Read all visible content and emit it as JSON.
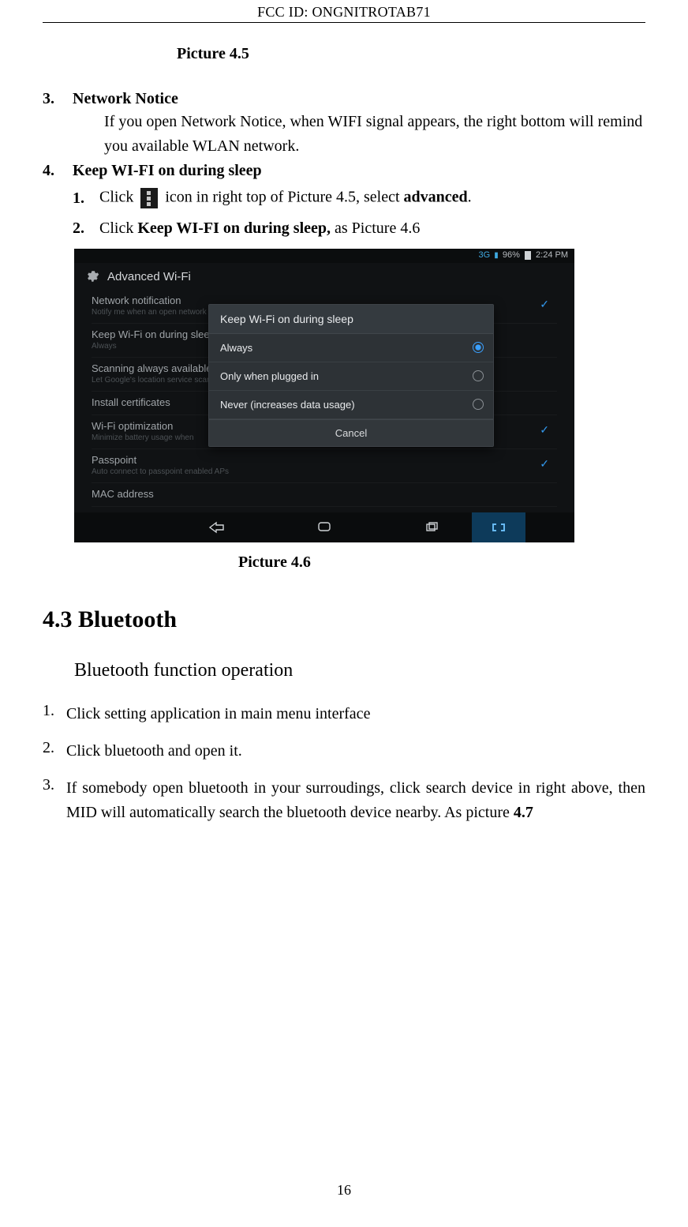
{
  "header": {
    "fcc_id": "FCC ID:  ONGNITROTAB71"
  },
  "captions": {
    "picture_45": "Picture 4.5",
    "picture_46": "Picture 4.6"
  },
  "list_main": {
    "item3": {
      "num": "3.",
      "heading": "Network Notice",
      "body": "If you open Network Notice, when WIFI signal appears, the right bottom will remind you available WLAN network."
    },
    "item4": {
      "num": "4.",
      "heading": "Keep WI-FI on during sleep",
      "sub1": {
        "num": "1.",
        "prefix": "Click ",
        "iconName": "menu-dots-icon",
        "mid": " icon in right top of Picture 4.5, select ",
        "bold": "advanced",
        "suffix": "."
      },
      "sub2": {
        "num": "2.",
        "prefix": "Click ",
        "bold": "Keep WI-FI on during sleep,",
        "suffix": " as Picture 4.6"
      }
    }
  },
  "screenshot": {
    "status": {
      "signal": "3G",
      "battery_pct": "96%",
      "time": "2:24 PM"
    },
    "title": "Advanced Wi-Fi",
    "rows": {
      "r1": {
        "title": "Network notification",
        "sub": "Notify me when an open network is available",
        "checked": true
      },
      "r2": {
        "title": "Keep Wi-Fi on during sleep",
        "sub": "Always"
      },
      "r3": {
        "title": "Scanning always available",
        "sub": "Let Google's location service scan"
      },
      "r4": {
        "title": "Install certificates",
        "sub": ""
      },
      "r5": {
        "title": "Wi-Fi optimization",
        "sub": "Minimize battery usage when",
        "checked": true
      },
      "r6": {
        "title": "Passpoint",
        "sub": "Auto connect to passpoint enabled APs",
        "checked": true
      },
      "r7": {
        "title": "MAC address",
        "sub": ""
      }
    },
    "dialog": {
      "title": "Keep Wi-Fi on during sleep",
      "opt1": "Always",
      "opt2": "Only when plugged in",
      "opt3": "Never (increases data usage)",
      "cancel": "Cancel"
    },
    "nav": {
      "back": "back",
      "home": "home",
      "recent": "recent",
      "screenshot": "screenshot"
    }
  },
  "section43": {
    "heading": "4.3    Bluetooth",
    "sub": "Bluetooth function operation",
    "items": {
      "i1": {
        "num": "1.",
        "text": "Click setting application in main menu interface"
      },
      "i2": {
        "num": "2.",
        "text": "Click bluetooth and open it."
      },
      "i3": {
        "num": "3.",
        "prefix": "If somebody open bluetooth in your surroudings, click search device in right above, then MID will automatically search the bluetooth device nearby. As picture ",
        "bold": "4.7"
      }
    }
  },
  "page_number": "16"
}
